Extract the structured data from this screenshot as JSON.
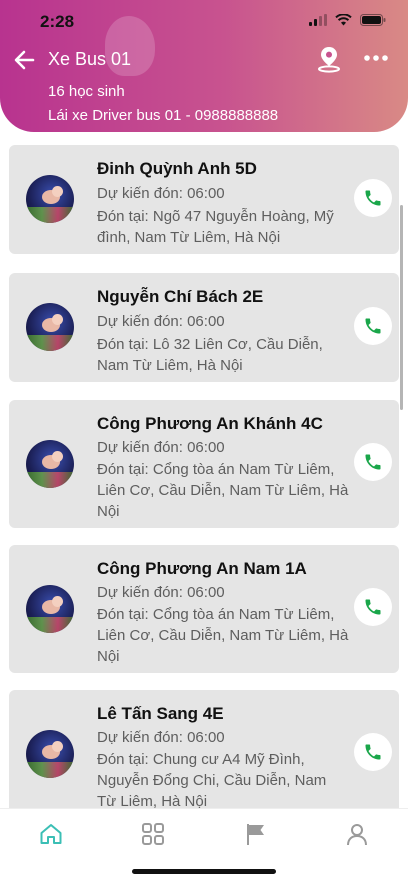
{
  "status_bar": {
    "time": "2:28"
  },
  "header": {
    "title": "Xe Bus 01",
    "student_count": "16 học sinh",
    "driver_line": "Lái xe Driver bus 01 - 0988888888"
  },
  "students": [
    {
      "name": "Đinh Quỳnh Anh 5D",
      "pickup_time": "Dự kiến đón: 06:00",
      "pickup_place": "Đón tại: Ngõ 47 Nguyễn Hoàng, Mỹ đình, Nam Từ Liêm, Hà Nội"
    },
    {
      "name": "Nguyễn Chí Bách 2E",
      "pickup_time": "Dự kiến đón: 06:00",
      "pickup_place": "Đón tại: Lô 32 Liên Cơ, Cầu Diễn, Nam Từ Liêm, Hà Nội"
    },
    {
      "name": "Công Phương An Khánh 4C",
      "pickup_time": "Dự kiến đón: 06:00",
      "pickup_place": "Đón tại: Cổng tòa án Nam Từ Liêm, Liên Cơ, Cầu Diễn, Nam Từ Liêm, Hà Nội"
    },
    {
      "name": "Công Phương An Nam 1A",
      "pickup_time": "Dự kiến đón: 06:00",
      "pickup_place": "Đón tại: Cổng tòa án Nam Từ Liêm, Liên Cơ, Cầu Diễn, Nam Từ Liêm, Hà Nội"
    },
    {
      "name": "Lê Tấn Sang 4E",
      "pickup_time": "Dự kiến đón: 06:00",
      "pickup_place": "Đón tại: Chung cư A4 Mỹ Đình, Nguyễn Đổng Chi, Cầu Diễn, Nam Từ Liêm, Hà Nội"
    }
  ],
  "tabbar": {
    "icons": [
      "home-icon",
      "grid-icon",
      "flag-icon",
      "profile-icon"
    ],
    "active_color": "#3bbfb5",
    "inactive_color": "#9a9a9a"
  },
  "colors": {
    "call_green": "#1aa64a",
    "header_start": "#b8338f",
    "header_end": "#d98a85"
  }
}
